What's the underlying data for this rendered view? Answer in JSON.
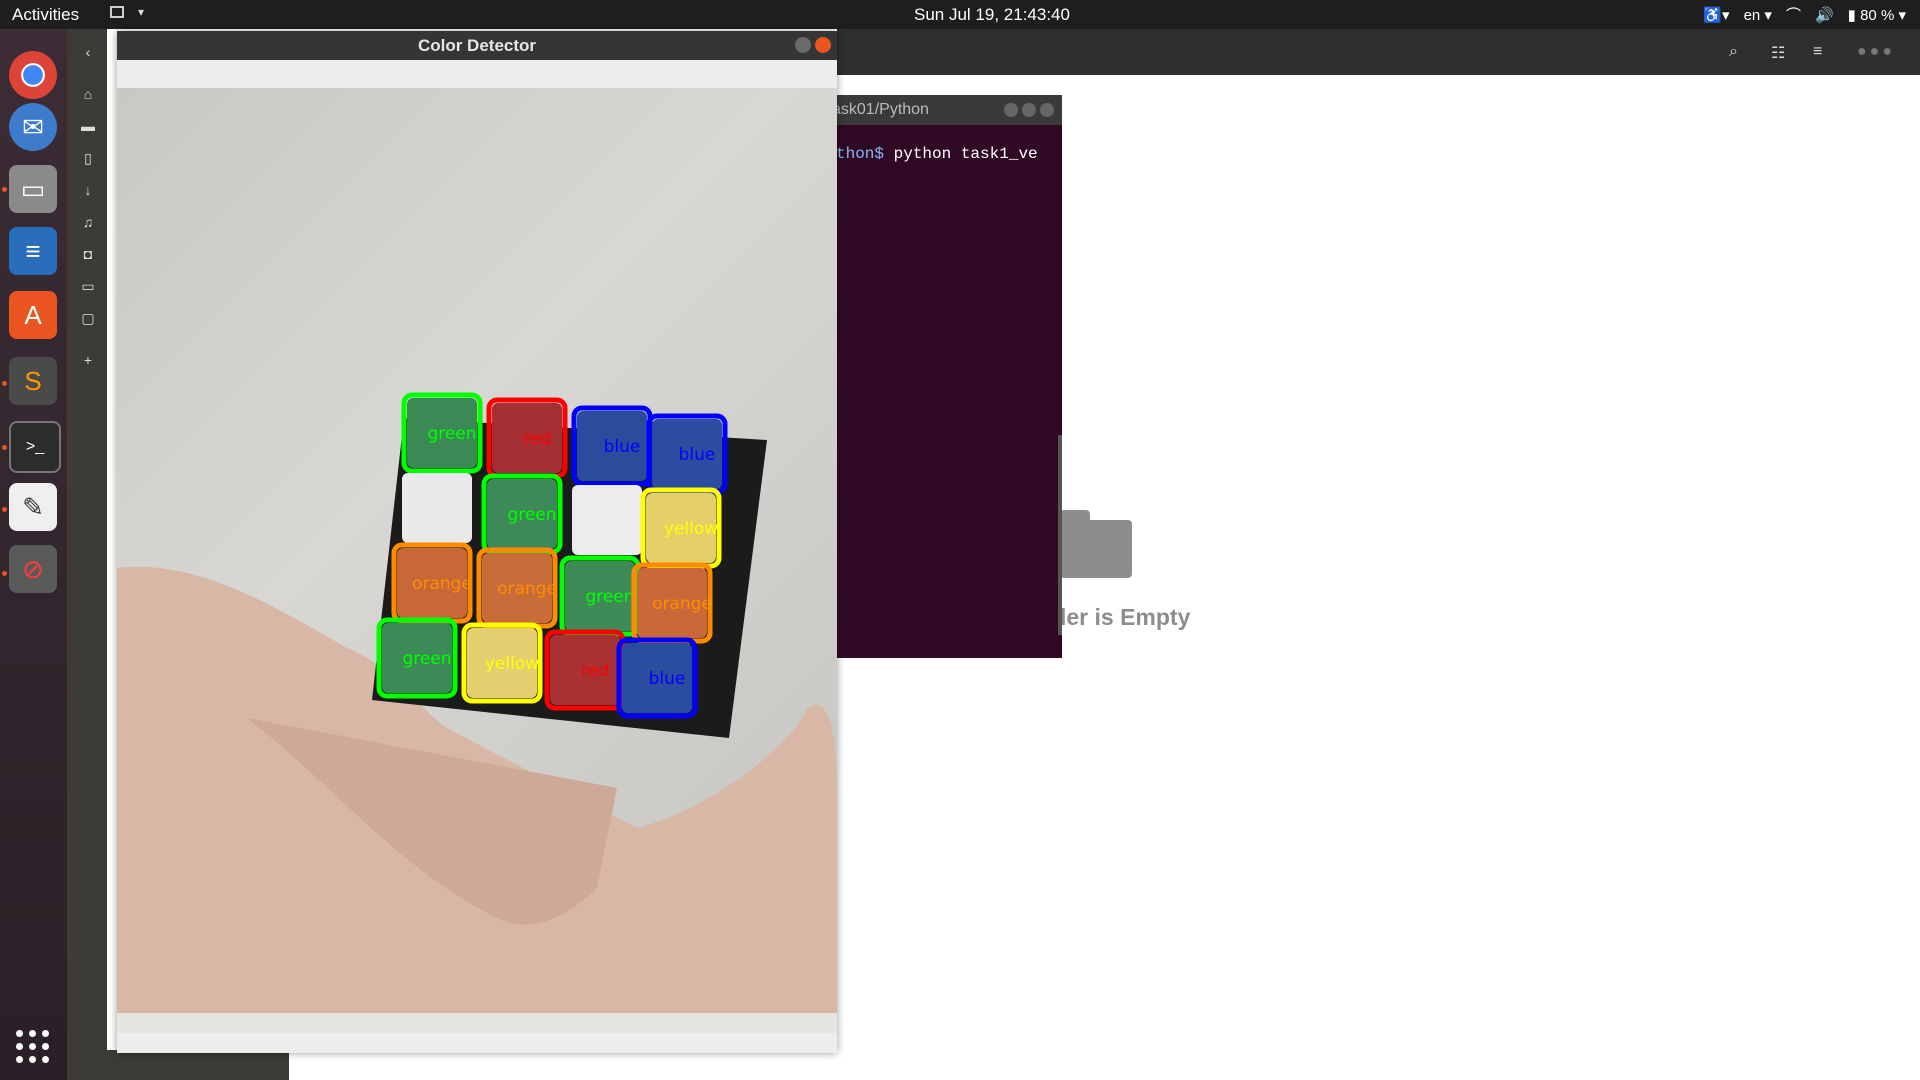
{
  "topbar": {
    "activities": "Activities",
    "clock": "Sun Jul 19, 21:43:40",
    "lang": "en",
    "battery": "80 %"
  },
  "dock": {
    "apps": [
      "chrome-icon",
      "thunderbird-icon",
      "files-icon",
      "writer-icon",
      "software-icon",
      "sublime-icon",
      "terminal-icon",
      "text-editor-icon",
      "color-detector-icon"
    ]
  },
  "terminal": {
    "title": "ask01/Python",
    "prompt": "thon$",
    "command": " python task1_ve"
  },
  "files": {
    "empty_text": "ler is Empty"
  },
  "color_detector": {
    "title": "Color Detector",
    "stickers": [
      {
        "label": "green",
        "color": "#00ff00"
      },
      {
        "label": "red",
        "color": "#ff0000"
      },
      {
        "label": "blue",
        "color": "#0000ff"
      },
      {
        "label": "green",
        "color": "#00ff00"
      },
      {
        "label": "yellow",
        "color": "#ffff00"
      },
      {
        "label": "orange",
        "color": "#ff8c00"
      },
      {
        "label": "orange",
        "color": "#ff8c00"
      },
      {
        "label": "green",
        "color": "#00ff00"
      },
      {
        "label": "orange",
        "color": "#ff8c00"
      },
      {
        "label": "green",
        "color": "#00ff00"
      },
      {
        "label": "yellow",
        "color": "#ffff00"
      },
      {
        "label": "red",
        "color": "#ff0000"
      },
      {
        "label": "blue",
        "color": "#0000ff"
      }
    ]
  }
}
